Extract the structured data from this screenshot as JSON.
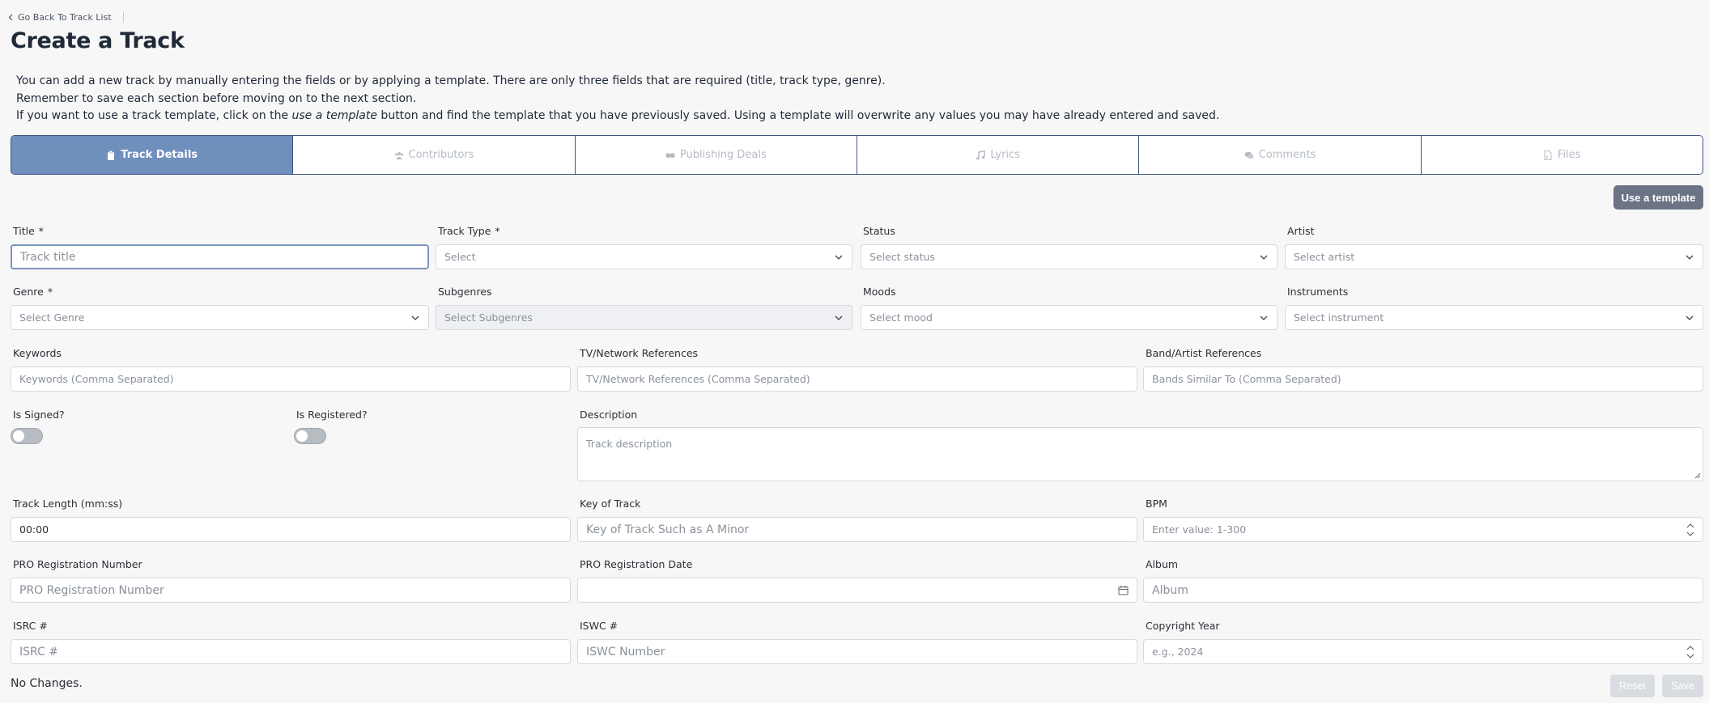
{
  "nav": {
    "back_label": "Go Back To Track List"
  },
  "page": {
    "title": "Create a Track"
  },
  "intro": {
    "line1": "You can add a new track by manually entering the fields or by applying a template. There are only three fields that are required (title, track type, genre).",
    "line2": "Remember to save each section before moving on to the next section.",
    "line3_pre": "If you want to use a track template, click on the ",
    "line3_em": "use a template",
    "line3_post": " button and find the template that you have previously saved. Using a template will overwrite any values you may have already entered and saved."
  },
  "tabs": [
    {
      "label": "Track Details",
      "icon": "clipboard-icon",
      "active": true
    },
    {
      "label": "Contributors",
      "icon": "users-icon",
      "active": false
    },
    {
      "label": "Publishing Deals",
      "icon": "handshake-icon",
      "active": false
    },
    {
      "label": "Lyrics",
      "icon": "music-note-icon",
      "active": false
    },
    {
      "label": "Comments",
      "icon": "comments-icon",
      "active": false
    },
    {
      "label": "Files",
      "icon": "file-audio-icon",
      "active": false
    }
  ],
  "template_button": "Use a template",
  "required_mark": "*",
  "fields": {
    "title": {
      "label": "Title",
      "placeholder": "Track title"
    },
    "track_type": {
      "label": "Track Type",
      "placeholder": "Select"
    },
    "status": {
      "label": "Status",
      "placeholder": "Select status"
    },
    "artist": {
      "label": "Artist",
      "placeholder": "Select artist"
    },
    "genre": {
      "label": "Genre",
      "placeholder": "Select Genre"
    },
    "subgenres": {
      "label": "Subgenres",
      "placeholder": "Select Subgenres"
    },
    "moods": {
      "label": "Moods",
      "placeholder": "Select mood"
    },
    "instruments": {
      "label": "Instruments",
      "placeholder": "Select instrument"
    },
    "keywords": {
      "label": "Keywords",
      "placeholder": "Keywords (Comma Separated)"
    },
    "tv_refs": {
      "label": "TV/Network References",
      "placeholder": "TV/Network References (Comma Separated)"
    },
    "band_refs": {
      "label": "Band/Artist References",
      "placeholder": "Bands Similar To (Comma Separated)"
    },
    "is_signed": {
      "label": "Is Signed?"
    },
    "is_registered": {
      "label": "Is Registered?"
    },
    "description": {
      "label": "Description",
      "placeholder": "Track description"
    },
    "track_length": {
      "label": "Track Length (mm:ss)",
      "value": "00:00"
    },
    "key": {
      "label": "Key of Track",
      "placeholder": "Key of Track Such as A Minor"
    },
    "bpm": {
      "label": "BPM",
      "placeholder": "Enter value: 1-300"
    },
    "pro_number": {
      "label": "PRO Registration Number",
      "placeholder": "PRO Registration Number"
    },
    "pro_date": {
      "label": "PRO Registration Date",
      "placeholder": ""
    },
    "album": {
      "label": "Album",
      "placeholder": "Album"
    },
    "isrc": {
      "label": "ISRC #",
      "placeholder": "ISRC #"
    },
    "iswc": {
      "label": "ISWC #",
      "placeholder": "ISWC Number"
    },
    "copyright_year": {
      "label": "Copyright Year",
      "placeholder": "e.g., 2024"
    }
  },
  "footer": {
    "status": "No Changes.",
    "reset_label": "Reset",
    "save_label": "Save"
  },
  "colors": {
    "accent": "#6f8fbd",
    "tab_border": "#3d5680",
    "template_button": "#6b7485"
  }
}
